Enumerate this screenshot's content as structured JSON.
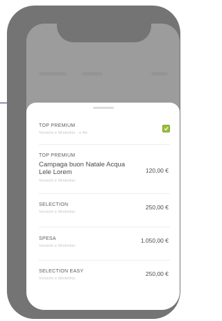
{
  "sheet": {
    "items": [
      {
        "title": "TOP PREMIUM",
        "subtitle": "Vorsicht e Wintethio · e Ab",
        "selected": true
      },
      {
        "title": "TOP PREMIUM",
        "main": "Campaga buon Natale Acqua Lele Lorem",
        "subtitle": "Vorsicht e Wintethio",
        "price": "120,00 €"
      },
      {
        "title": "SELECTION",
        "subtitle": "Vorsicht e Wintethio",
        "price": "250,00 €"
      },
      {
        "title": "SPESA",
        "subtitle": "Vorsicht e Wintethio",
        "price": "1.050,00 €"
      },
      {
        "title": "SELECTION EASY",
        "subtitle": "Vorsicht e Wintethio",
        "price": "250,00 €"
      }
    ]
  },
  "colors": {
    "frame": "#747474",
    "overlay": "#9c9c9c",
    "check": "#9bbf3a"
  },
  "icons": {
    "selected": "check-icon"
  }
}
